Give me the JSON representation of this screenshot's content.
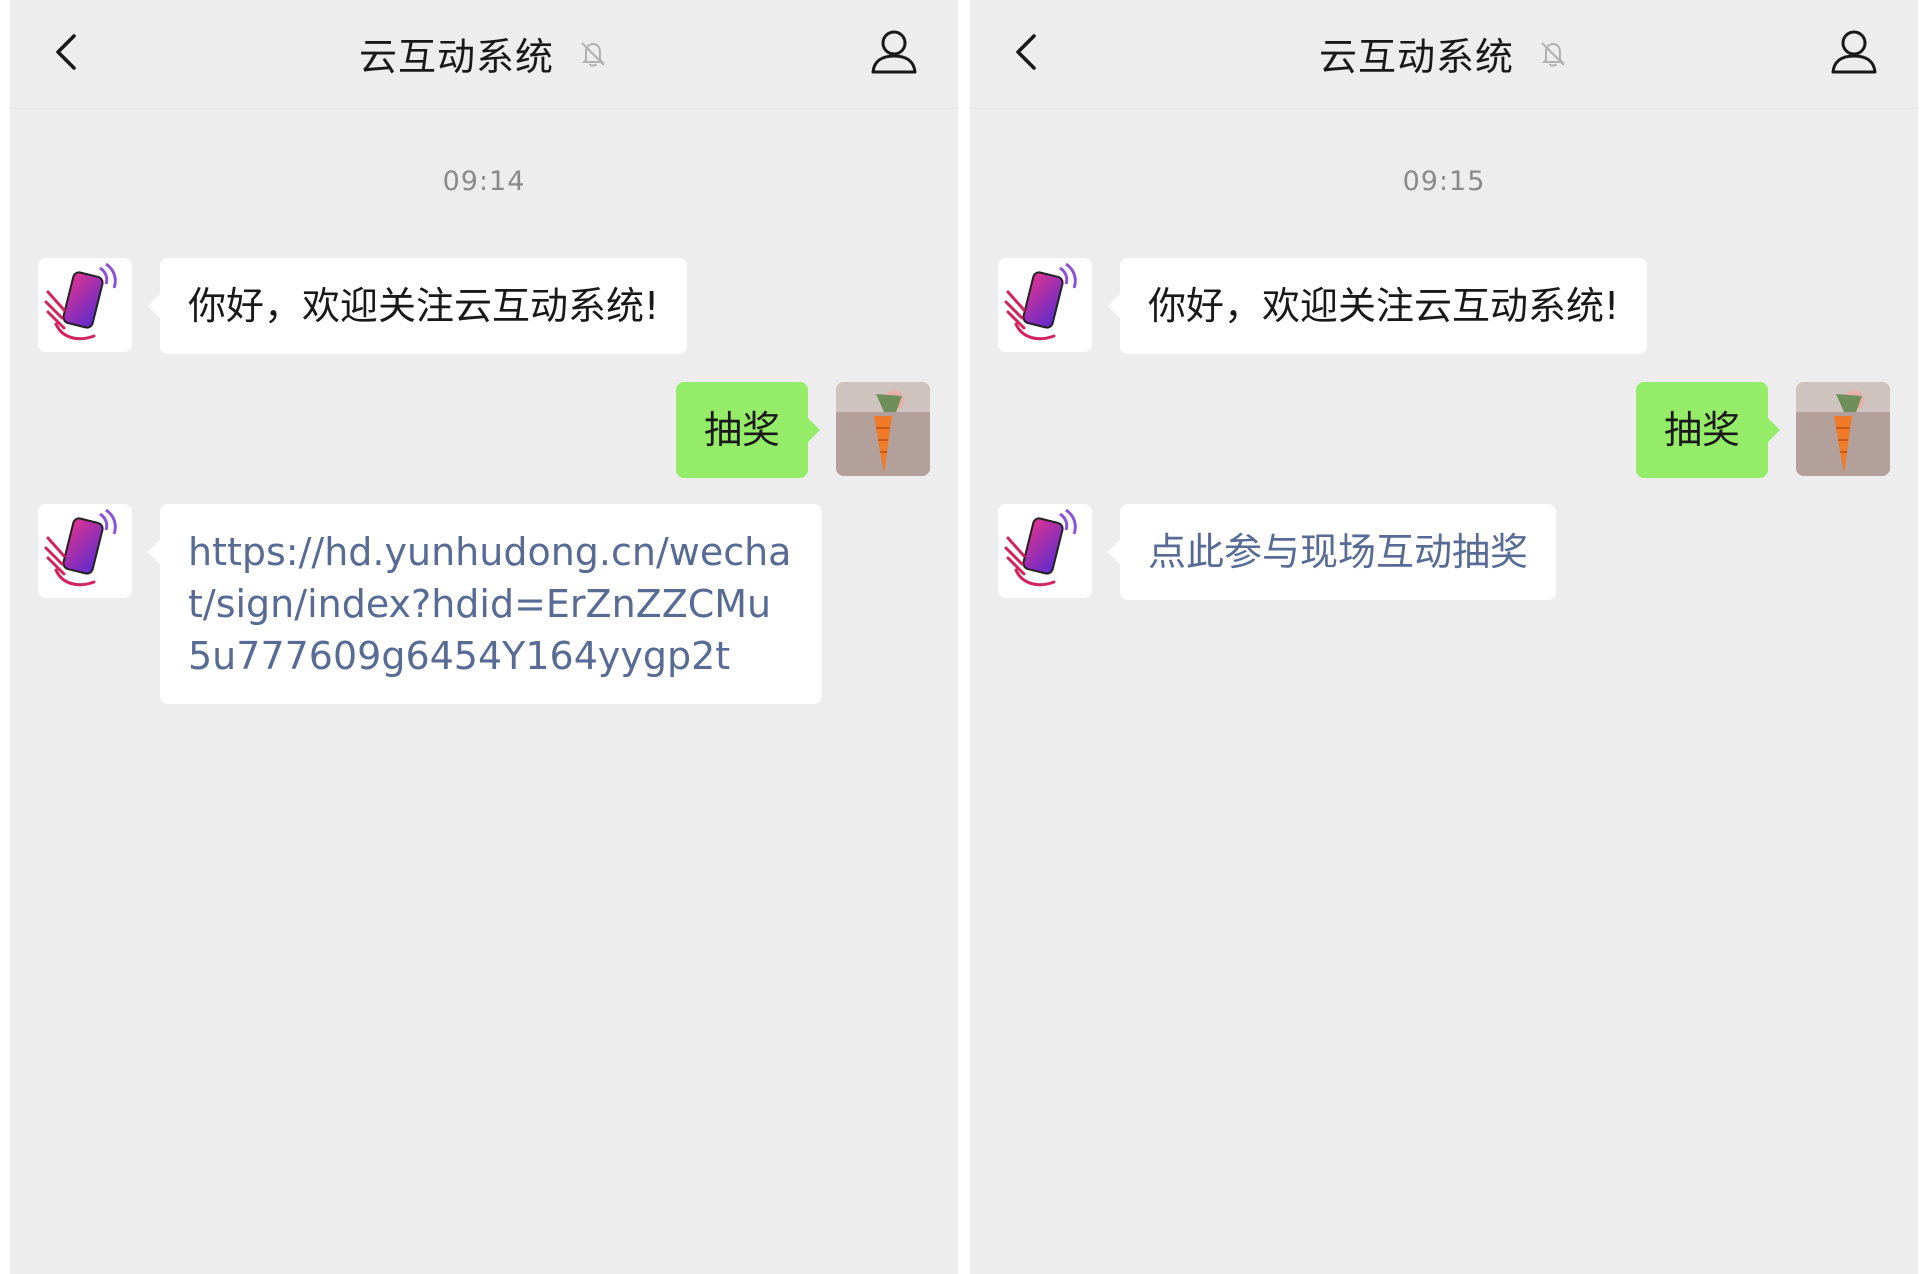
{
  "left_panel": {
    "title": "云互动系统",
    "timestamp": "09:14",
    "messages": {
      "welcome": "你好，欢迎关注云互动系统!",
      "user_msg": "抽奖",
      "link_reply": "https://hd.yunhudong.cn/wechat/sign/index?hdid=ErZnZZCMu5u777609g6454Y164yygp2t"
    }
  },
  "right_panel": {
    "title": "云互动系统",
    "timestamp": "09:15",
    "messages": {
      "welcome": "你好，欢迎关注云互动系统!",
      "user_msg": "抽奖",
      "link_reply": "点此参与现场互动抽奖"
    }
  },
  "colors": {
    "background": "#ededed",
    "incoming_bubble": "#ffffff",
    "outgoing_bubble": "#95ec69",
    "link_text": "#576b95"
  },
  "icons": {
    "back": "chevron-left-icon",
    "mute": "bell-off-icon",
    "profile": "person-icon",
    "bot_avatar": "phone-hand-logo",
    "user_avatar": "carrot-photo"
  }
}
